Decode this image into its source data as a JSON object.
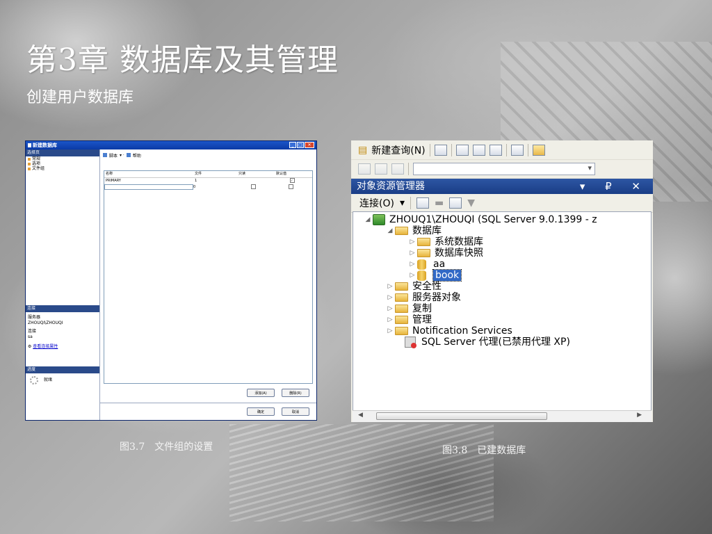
{
  "slide": {
    "title_part1": "第3章",
    "title_part2": "数据库及其管理",
    "subtitle": "创建用户数据库",
    "caption_left": "图3.7　文件组的设置",
    "caption_right": "图3.8　已建数据库"
  },
  "dialog": {
    "title": "新建数据库",
    "select_page_header": "选择页",
    "pages": [
      "常规",
      "选项",
      "文件组"
    ],
    "toolbar": {
      "script": "脚本",
      "help": "帮助"
    },
    "grid_headers": [
      "名称",
      "文件",
      "只读",
      "默认值"
    ],
    "rows": [
      {
        "name": "PRIMARY",
        "files": "1",
        "readonly": false,
        "default": true
      },
      {
        "name": "",
        "files": "0",
        "readonly": false,
        "default": false
      }
    ],
    "connection_header": "连接",
    "server_label": "服务器",
    "server_value": "ZHOUQI\\ZHOUQI",
    "connection_label": "连接",
    "connection_value": "sa",
    "view_props_link": "查看连接属性",
    "progress_header": "进度",
    "progress_status": "就绪",
    "add_button": "添加(A)",
    "remove_button": "删除(R)",
    "ok_button": "确定",
    "cancel_button": "取消"
  },
  "explorer": {
    "new_query": "新建查询(N)",
    "panel_title": "对象资源管理器",
    "title_controls": "▾ ₽ ✕",
    "connect": "连接(O)",
    "server_node": "ZHOUQ1\\ZHOUQI (SQL Server 9.0.1399 - z",
    "tree": [
      {
        "label": "数据库",
        "icon": "folder-icon"
      },
      {
        "label": "系统数据库",
        "icon": "folder-icon"
      },
      {
        "label": "数据库快照",
        "icon": "folder-icon"
      },
      {
        "label": "aa",
        "icon": "database-icon"
      },
      {
        "label": "book",
        "icon": "database-icon"
      },
      {
        "label": "安全性",
        "icon": "folder-icon"
      },
      {
        "label": "服务器对象",
        "icon": "folder-icon"
      },
      {
        "label": "复制",
        "icon": "folder-icon"
      },
      {
        "label": "管理",
        "icon": "folder-icon"
      },
      {
        "label": "Notification Services",
        "icon": "folder-icon"
      },
      {
        "label": "SQL Server 代理(已禁用代理 XP)",
        "icon": "agent-icon"
      }
    ]
  }
}
